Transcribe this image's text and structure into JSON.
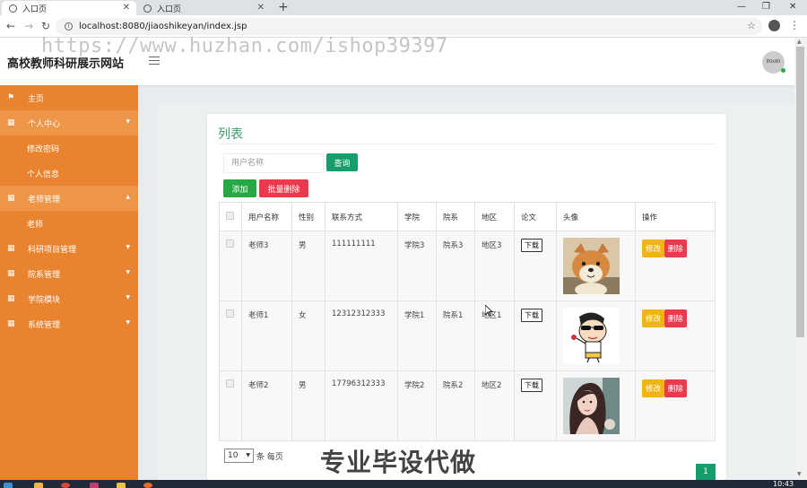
{
  "browser": {
    "tabs": [
      {
        "title": "入口页",
        "active": true
      },
      {
        "title": "入口页",
        "active": false
      }
    ],
    "url": "localhost:8080/jiaoshikeyan/index.jsp"
  },
  "header": {
    "site_title": "高校教师科研展示网站",
    "watermark": "https://www.huzhan.com/ishop39397",
    "avatar_text": "80x80"
  },
  "sidebar": {
    "items": [
      {
        "label": "主页",
        "icon": "flag-icon"
      },
      {
        "label": "个人中心",
        "icon": "grid-icon",
        "open": true,
        "children": [
          "修改密码",
          "个人信息"
        ]
      },
      {
        "label": "老师管理",
        "icon": "grid-icon",
        "open": true,
        "children": [
          "老师"
        ]
      },
      {
        "label": "科研项目管理",
        "icon": "grid-icon"
      },
      {
        "label": "院系管理",
        "icon": "grid-icon"
      },
      {
        "label": "学院模块",
        "icon": "grid-icon"
      },
      {
        "label": "系统管理",
        "icon": "grid-icon"
      }
    ]
  },
  "content": {
    "title": "列表",
    "search_placeholder": "用户名称",
    "query_label": "查询",
    "add_label": "添加",
    "batch_delete_label": "批量删除",
    "table": {
      "headers": [
        "用户名称",
        "性别",
        "联系方式",
        "学院",
        "院系",
        "地区",
        "论文",
        "头像",
        "操作"
      ],
      "rows": [
        {
          "name": "老师3",
          "gender": "男",
          "phone": "111111111",
          "college": "学院3",
          "dept": "院系3",
          "region": "地区3",
          "paper": "下载",
          "avatar": "shiba-dog-photo"
        },
        {
          "name": "老师1",
          "gender": "女",
          "phone": "12312312333",
          "college": "学院1",
          "dept": "院系1",
          "region": "地区1",
          "paper": "下载",
          "avatar": "cartoon-boy-image"
        },
        {
          "name": "老师2",
          "gender": "男",
          "phone": "17796312333",
          "college": "学院2",
          "dept": "院系2",
          "region": "地区2",
          "paper": "下载",
          "avatar": "woman-portrait-photo"
        }
      ],
      "edit_label": "修改",
      "delete_label": "删除"
    },
    "pager": {
      "per_page": "10",
      "per_page_suffix": "条 每页",
      "current_page": "1"
    },
    "overlay_banner": "专业毕设代做"
  },
  "taskbar": {
    "clock": "10:43"
  },
  "colors": {
    "sidebar": "#e9832f",
    "accent_green": "#179c6b",
    "danger": "#eb3a4e",
    "warning": "#f0b419",
    "title_green": "#3d9d6a"
  }
}
